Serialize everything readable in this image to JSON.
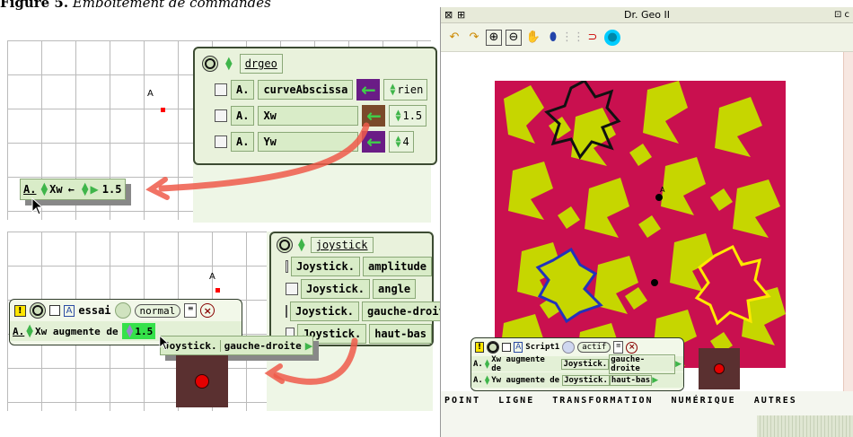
{
  "figure": {
    "label": "Figure 5.",
    "caption": "Emboîtement de commandes"
  },
  "left_top": {
    "point_label": "A",
    "drgeo_morph": {
      "title": "drgeo",
      "rows": [
        {
          "prefix": "A.",
          "name": "curveAbscissa",
          "value": "rien"
        },
        {
          "prefix": "A.",
          "name": "Xw",
          "value": "1.5"
        },
        {
          "prefix": "A.",
          "name": "Yw",
          "value": "4"
        }
      ]
    },
    "assign_tile": {
      "prefix": "A.",
      "var": "Xw",
      "arrow": "←",
      "value": "1.5"
    }
  },
  "left_bottom": {
    "point_label": "A",
    "script": {
      "name": "essai",
      "mode": "normal",
      "prefix": "A.",
      "statement": "Xw augmente de",
      "value": "1.5",
      "dragged_tile": {
        "object": "Joystick.",
        "property": "gauche-droite"
      }
    },
    "joystick_morph": {
      "title": "joystick",
      "rows": [
        {
          "object": "Joystick.",
          "property": "amplitude"
        },
        {
          "object": "Joystick.",
          "property": "angle"
        },
        {
          "object": "Joystick.",
          "property": "gauche-droite"
        },
        {
          "object": "Joystick.",
          "property": "haut-bas"
        }
      ]
    }
  },
  "drgeo_window": {
    "title": "Dr. Geo II",
    "point_label": "A",
    "script": {
      "name": "Script1",
      "mode": "actif",
      "lines": [
        {
          "prefix": "A.",
          "statement": "Xw augmente de",
          "object": "Joystick.",
          "property": "gauche-droite"
        },
        {
          "prefix": "A.",
          "statement": "Yw augmente de",
          "object": "Joystick.",
          "property": "haut-bas"
        }
      ]
    },
    "tabs": [
      "POINT",
      "LIGNE",
      "TRANSFORMATION",
      "NUMÉRIQUE",
      "AUTRES"
    ]
  },
  "colors": {
    "magenta": "#c9104f",
    "yellow": "#c6d600",
    "joystick_bg": "#5a3030",
    "joystick_knob": "#e40000",
    "red_arrow": "#ef5a4a"
  }
}
